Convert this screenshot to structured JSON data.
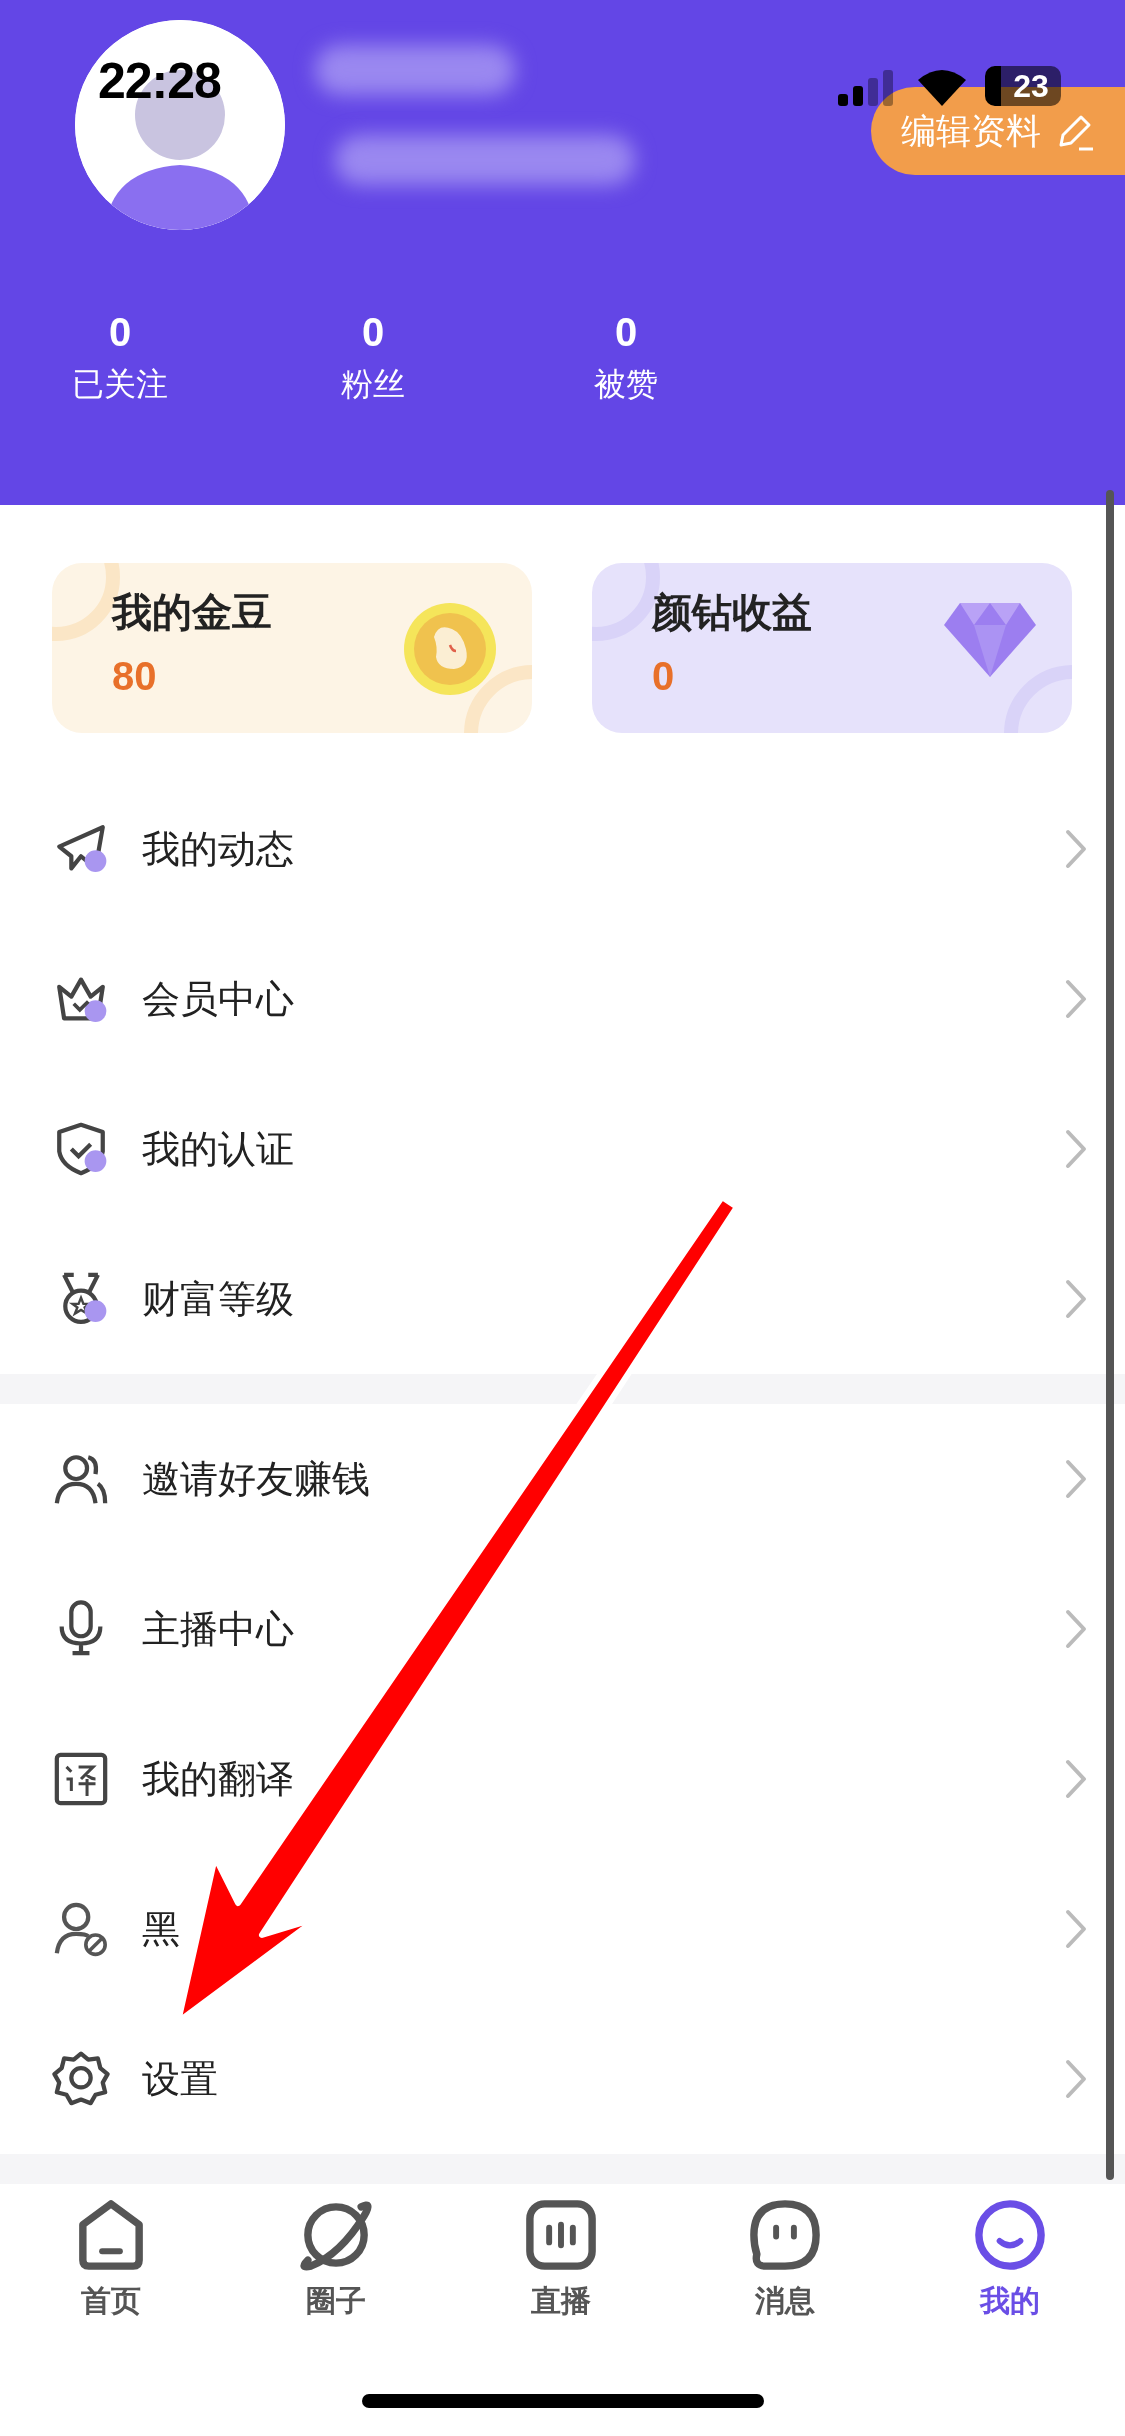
{
  "status_bar": {
    "time": "22:28",
    "battery": "23"
  },
  "profile": {
    "edit_button": "编辑资料",
    "stats": [
      {
        "value": "0",
        "label": "已关注"
      },
      {
        "value": "0",
        "label": "粉丝"
      },
      {
        "value": "0",
        "label": "被赞"
      }
    ]
  },
  "asset_cards": [
    {
      "kind": "coin",
      "title": "我的金豆",
      "value": "80"
    },
    {
      "kind": "diamond",
      "title": "颜钻收益",
      "value": "0"
    }
  ],
  "menu_groups": [
    [
      {
        "label": "我的动态"
      },
      {
        "label": "会员中心"
      },
      {
        "label": "我的认证"
      },
      {
        "label": "财富等级"
      }
    ],
    [
      {
        "label": "邀请好友赚钱"
      },
      {
        "label": "主播中心"
      },
      {
        "label": "我的翻译"
      },
      {
        "label": "黑"
      },
      {
        "label": "设置"
      }
    ]
  ],
  "tab_bar": [
    {
      "label": "首页",
      "selected": false
    },
    {
      "label": "圈子",
      "selected": false
    },
    {
      "label": "直播",
      "selected": false
    },
    {
      "label": "消息",
      "selected": false
    },
    {
      "label": "我的",
      "selected": true
    }
  ]
}
